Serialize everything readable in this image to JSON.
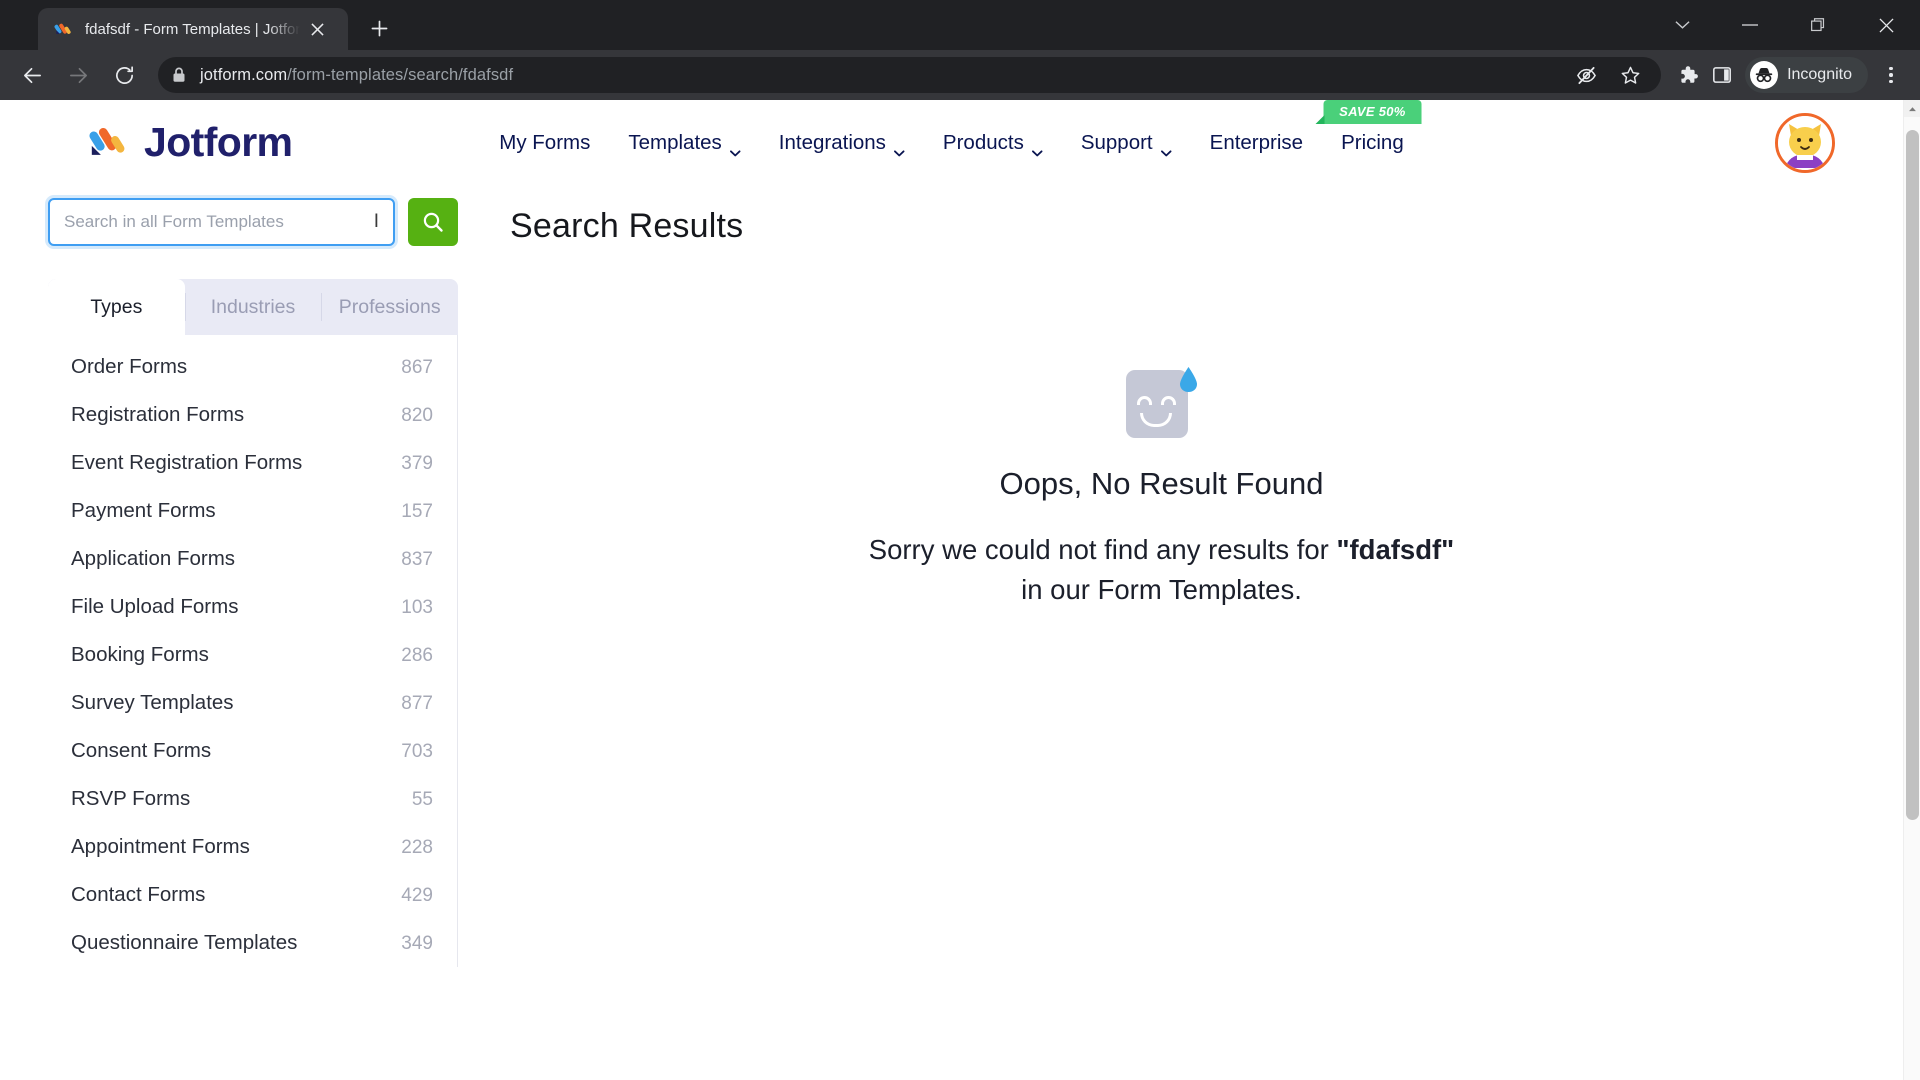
{
  "browser": {
    "tab": {
      "title": "fdafsdf - Form Templates | Jotform",
      "favicon_icon": "jotform-favicon",
      "close_icon": "close-icon"
    },
    "new_tab_icon": "plus-icon",
    "window_controls": [
      {
        "name": "tab-search",
        "icon": "chevron-down-icon",
        "glyph": "⌄"
      },
      {
        "name": "minimize",
        "icon": "minimize-icon",
        "glyph": "–"
      },
      {
        "name": "maximize",
        "icon": "restore-icon",
        "glyph": "❐"
      },
      {
        "name": "close",
        "icon": "close-icon",
        "glyph": "✕"
      }
    ],
    "back_icon": "back-arrow-icon",
    "forward_icon": "forward-arrow-icon",
    "reload_icon": "reload-icon",
    "omnibox": {
      "lock_icon": "lock-icon",
      "url_host": "jotform.com",
      "url_path": "/form-templates/search/fdafsdf"
    },
    "omni_actions": [
      {
        "name": "tracking-protection",
        "icon": "eye-slash-icon"
      },
      {
        "name": "bookmark",
        "icon": "star-icon"
      }
    ],
    "extensions_icon": "puzzle-icon",
    "side_panel_icon": "side-panel-icon",
    "incognito": {
      "label": "Incognito",
      "icon": "incognito-icon"
    },
    "menu_icon": "kebab-menu-icon"
  },
  "site": {
    "logo_text": "Jotform",
    "nav": [
      {
        "label": "My Forms",
        "has_chevron": false
      },
      {
        "label": "Templates",
        "has_chevron": true
      },
      {
        "label": "Integrations",
        "has_chevron": true
      },
      {
        "label": "Products",
        "has_chevron": true
      },
      {
        "label": "Support",
        "has_chevron": true
      },
      {
        "label": "Enterprise",
        "has_chevron": false
      },
      {
        "label": "Pricing",
        "has_chevron": false
      }
    ],
    "promo_badge": "SAVE 50%",
    "avatar_icon": "user-avatar-cat"
  },
  "search": {
    "value": "",
    "placeholder": "Search in all Form Templates",
    "button_icon": "search-icon"
  },
  "tabs": [
    {
      "label": "Types",
      "active": true
    },
    {
      "label": "Industries",
      "active": false
    },
    {
      "label": "Professions",
      "active": false
    }
  ],
  "categories": [
    {
      "label": "Order Forms",
      "count": "867"
    },
    {
      "label": "Registration Forms",
      "count": "820"
    },
    {
      "label": "Event Registration Forms",
      "count": "379"
    },
    {
      "label": "Payment Forms",
      "count": "157"
    },
    {
      "label": "Application Forms",
      "count": "837"
    },
    {
      "label": "File Upload Forms",
      "count": "103"
    },
    {
      "label": "Booking Forms",
      "count": "286"
    },
    {
      "label": "Survey Templates",
      "count": "877"
    },
    {
      "label": "Consent Forms",
      "count": "703"
    },
    {
      "label": "RSVP Forms",
      "count": "55"
    },
    {
      "label": "Appointment Forms",
      "count": "228"
    },
    {
      "label": "Contact Forms",
      "count": "429"
    },
    {
      "label": "Questionnaire Templates",
      "count": "349"
    }
  ],
  "main": {
    "title": "Search Results",
    "empty_icon": "sad-face-icon",
    "empty_heading": "Oops, No Result Found",
    "empty_line1_prefix": "Sorry we could not find any results for ",
    "empty_query": "\"fdafsdf\"",
    "empty_line2": "in our Form Templates."
  },
  "colors": {
    "brand_navy": "#20206b",
    "search_green": "#56b112",
    "promo_green": "#4ad07a",
    "focus_blue": "#3f9ef2"
  }
}
